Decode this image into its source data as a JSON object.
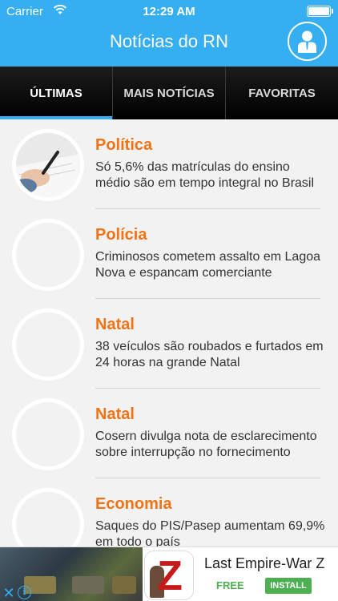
{
  "status_bar": {
    "carrier": "Carrier",
    "time": "12:29 AM",
    "wifi_icon": "wifi-icon",
    "battery_icon": "battery-icon"
  },
  "nav": {
    "title": "Notícias do RN",
    "profile_icon": "user-profile-icon"
  },
  "tabs": [
    {
      "label": "ÚLTIMAS",
      "active": true
    },
    {
      "label": "MAIS NOTÍCIAS",
      "active": false
    },
    {
      "label": "FAVORITAS",
      "active": false
    }
  ],
  "news": [
    {
      "category": "Política",
      "summary": "Só 5,6% das matrículas do ensino médio são em tempo integral no Brasil",
      "has_photo": true
    },
    {
      "category": "Polícia",
      "summary": "Criminosos cometem assalto em Lagoa Nova e espancam comerciante",
      "has_photo": false
    },
    {
      "category": "Natal",
      "summary": "38 veículos são roubados e furtados em 24 horas na grande Natal",
      "has_photo": false
    },
    {
      "category": "Natal",
      "summary": "Cosern divulga nota de esclarecimento sobre interrupção no fornecimento",
      "has_photo": false
    },
    {
      "category": "Economia",
      "summary": "Saques do PIS/Pasep aumentam 69,9% em todo o país",
      "has_photo": false
    }
  ],
  "ad": {
    "title": "Last Empire-War Z",
    "price": "FREE",
    "install_label": "INSTALL",
    "close_glyph": "✕",
    "info_glyph": "i",
    "close_icon": "close-icon",
    "info_icon": "info-icon"
  },
  "colors": {
    "primary": "#35aef2",
    "category": "#f07315",
    "install": "#4caf50"
  }
}
